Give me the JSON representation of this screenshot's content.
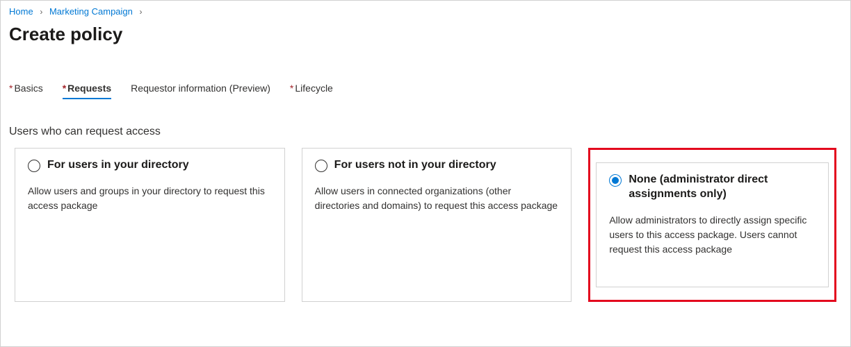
{
  "breadcrumb": {
    "items": [
      {
        "label": "Home"
      },
      {
        "label": "Marketing Campaign"
      }
    ]
  },
  "page_title": "Create policy",
  "tabs": [
    {
      "label": "Basics",
      "required": true,
      "active": false
    },
    {
      "label": "Requests",
      "required": true,
      "active": true
    },
    {
      "label": "Requestor information (Preview)",
      "required": false,
      "active": false
    },
    {
      "label": "Lifecycle",
      "required": true,
      "active": false
    }
  ],
  "section_heading": "Users who can request access",
  "options": [
    {
      "title": "For users in your directory",
      "description": "Allow users and groups in your directory to request this access package",
      "selected": false
    },
    {
      "title": "For users not in your directory",
      "description": "Allow users in connected organizations (other directories and domains) to request this access package",
      "selected": false
    },
    {
      "title": "None (administrator direct assignments only)",
      "description": "Allow administrators to directly assign specific users to this access package. Users cannot request this access package",
      "selected": true
    }
  ]
}
